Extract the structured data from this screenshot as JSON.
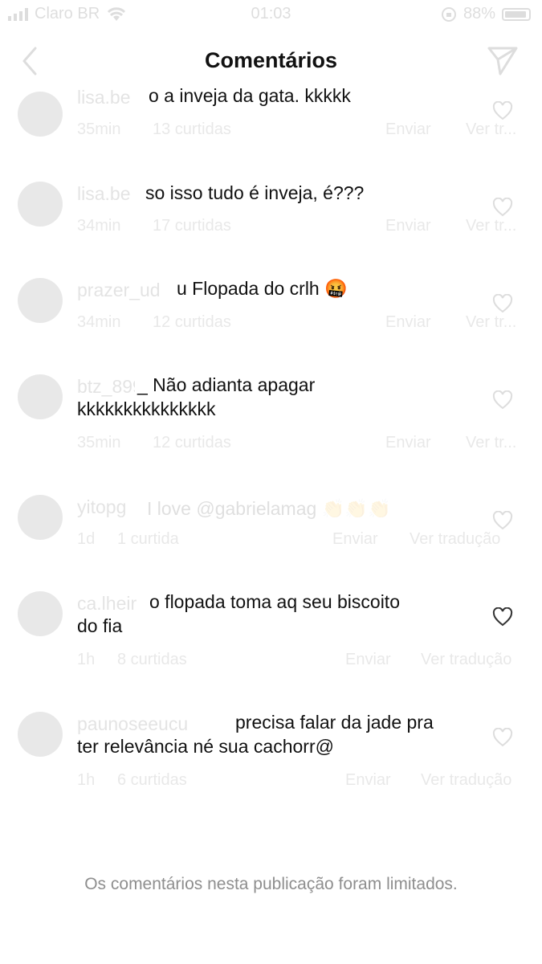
{
  "status_bar": {
    "carrier": "Claro BR",
    "time": "01:03",
    "battery": "88%"
  },
  "header": {
    "title": "Comentários"
  },
  "comments": [
    {
      "handle": "lisa.be",
      "text": "o a inveja da gata. kkkkk",
      "time": "35min",
      "likes": "13 curtidas",
      "reply": "Enviar",
      "translate": "Ver tr..."
    },
    {
      "handle": "lisa.be",
      "text": "so isso tudo é inveja, é???",
      "time": "34min",
      "likes": "17 curtidas",
      "reply": "Enviar",
      "translate": "Ver tr..."
    },
    {
      "handle": "prazer_ud",
      "text": "u Flopada do crlh 🤬",
      "time": "34min",
      "likes": "12 curtidas",
      "reply": "Enviar",
      "translate": "Ver tr..."
    },
    {
      "handle": "btz_899",
      "text": "_ Não adianta apagar",
      "text2": "kkkkkkkkkkkkkkk",
      "time": "35min",
      "likes": "12 curtidas",
      "reply": "Enviar",
      "translate": "Ver tr..."
    },
    {
      "handle": "yitopg",
      "text": "I love @gabrielamag 👏👏👏",
      "time": "1d",
      "likes": "1 curtida",
      "reply": "Enviar",
      "translate": "Ver tradução"
    },
    {
      "handle": "ca.lheir",
      "text": "o flopada toma aq seu biscoito",
      "text2": "do fia",
      "time": "1h",
      "likes": "8 curtidas",
      "reply": "Enviar",
      "translate": "Ver tradução"
    },
    {
      "handle": "paunoseeucu",
      "text": "precisa falar da jade pra",
      "text2": "ter relevância né sua cachorr@",
      "time": "1h",
      "likes": "6 curtidas",
      "reply": "Enviar",
      "translate": "Ver tradução"
    }
  ],
  "footer": {
    "limited_message": "Os comentários nesta publicação foram limitados."
  }
}
